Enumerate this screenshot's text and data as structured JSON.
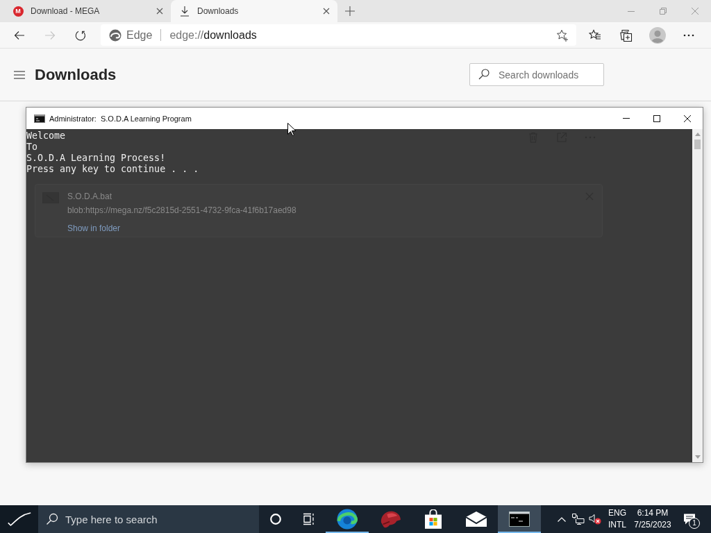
{
  "browser": {
    "tabs": [
      {
        "title": "Download - MEGA",
        "selected": false,
        "icon": {
          "kind": "badge",
          "text": "M"
        }
      },
      {
        "title": "Downloads",
        "selected": true,
        "icon": {
          "kind": "download"
        }
      }
    ],
    "nav": [
      {
        "kind": "back",
        "disabled": false
      },
      {
        "kind": "forward",
        "disabled": true
      },
      {
        "kind": "refresh",
        "disabled": false
      }
    ],
    "address": {
      "site_label": "Edge",
      "scheme": "edge://",
      "path": "downloads"
    }
  },
  "page": {
    "title": "Downloads",
    "search": {
      "placeholder": "Search downloads"
    },
    "downloads": [
      {
        "file_name": "S.O.D.A.bat",
        "source": "blob:https://mega.nz/f5c2815d-2551-4732-9fca-41f6b17aed98",
        "action": "Show in folder"
      }
    ]
  },
  "console": {
    "title": "Administrator:  S.O.D.A Learning Program",
    "lines": [
      "Welcome",
      "To",
      "S.O.D.A Learning Process!",
      "Press any key to continue . . ."
    ]
  },
  "taskbar": {
    "search": {
      "placeholder": "Type here to search"
    },
    "apps": [
      {
        "kind": "cortana",
        "open": false,
        "selected": false
      },
      {
        "kind": "task_view",
        "open": false,
        "selected": false
      },
      {
        "kind": "edge",
        "open": true,
        "selected": false
      },
      {
        "kind": "helmet",
        "open": false,
        "selected": false
      },
      {
        "kind": "store",
        "open": false,
        "selected": false
      },
      {
        "kind": "mail",
        "open": false,
        "selected": false
      },
      {
        "kind": "terminal",
        "open": true,
        "selected": true
      }
    ],
    "tray": {
      "volume_muted": true,
      "language": [
        "ENG",
        "INTL"
      ],
      "time": "6:14 PM",
      "date": "7/25/2023",
      "notification_count": "1"
    }
  }
}
